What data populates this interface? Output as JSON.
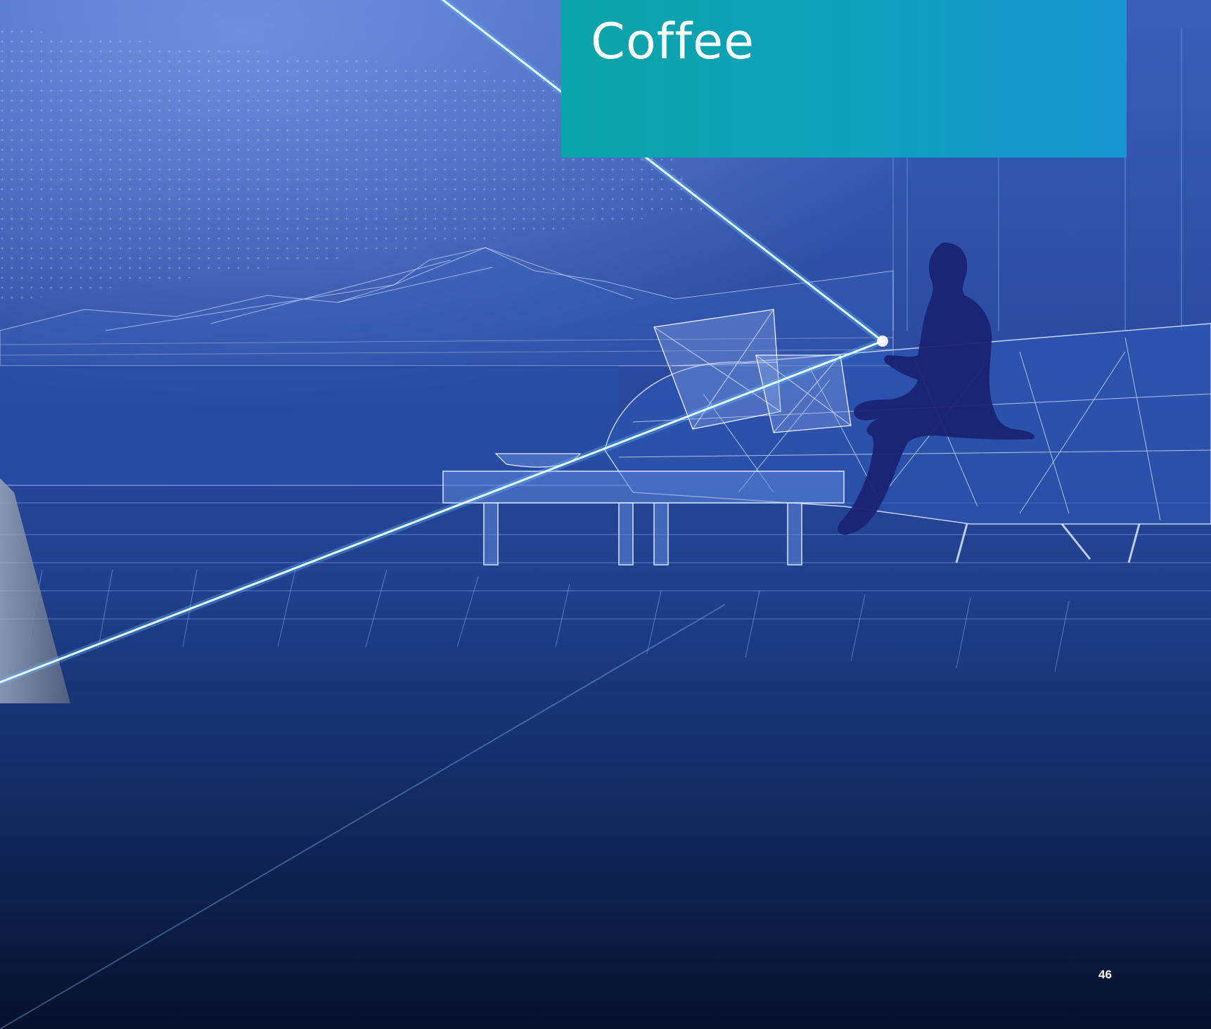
{
  "page": {
    "title": "Coffee",
    "page_number": "46"
  },
  "palette": {
    "title_panel": "#0fa0bd",
    "background_deep": "#0a1f4f",
    "background_sky": "#2a4fa8",
    "laser": "#bfefff",
    "silhouette": "#1a237e"
  },
  "illustration": {
    "subject": "woman-silhouette-on-wireframe-sofa",
    "elements": [
      "starfield",
      "wireframe-mountains",
      "wireframe-sofa",
      "cushions",
      "coffee-table",
      "bowl",
      "laser-beams",
      "floor-grid",
      "woman-silhouette"
    ]
  }
}
